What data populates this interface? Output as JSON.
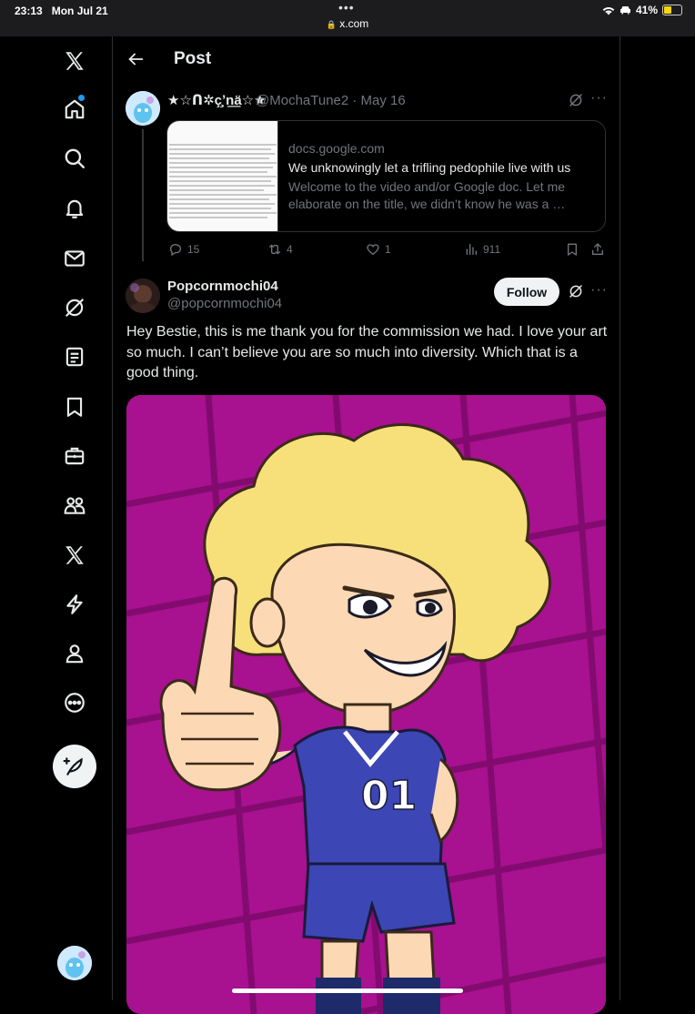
{
  "status_bar": {
    "time": "23:13",
    "date": "Mon Jul 21",
    "url": "x.com",
    "battery": "41%",
    "dots": "•••"
  },
  "header": {
    "title": "Post"
  },
  "parent_post": {
    "display_name": "★☆ᑎ✲ç̧ʼn͟ä☆★",
    "handle_date": "@MochaTune2 · May 16",
    "card": {
      "domain": "docs.google.com",
      "title": "We unknowingly let a trifling pedophile live with us",
      "description": "Welcome to the video and/or Google doc. Let me elaborate on the title, we didn’t know he was a …"
    },
    "stats": {
      "replies": "15",
      "reposts": "4",
      "likes": "1",
      "views": "911"
    }
  },
  "main_post": {
    "display_name": "Popcornmochi04",
    "handle": "@popcornmochi04",
    "follow_label": "Follow",
    "text": "Hey Bestie, this is me thank you for the commission we had. I love your art so much. I can’t believe you are so much into diversity. Which that is a good thing."
  },
  "more_glyph": "···",
  "colors": {
    "background": "#000000",
    "accent": "#1d9bf0",
    "media_background": "#a8118f"
  },
  "nav_icons": [
    "x-logo-icon",
    "home-icon",
    "search-icon",
    "notifications-icon",
    "messages-icon",
    "grok-icon",
    "lists-icon",
    "bookmarks-icon",
    "jobs-icon",
    "communities-icon",
    "premium-icon",
    "verified-orgs-icon",
    "profile-icon",
    "more-icon"
  ]
}
